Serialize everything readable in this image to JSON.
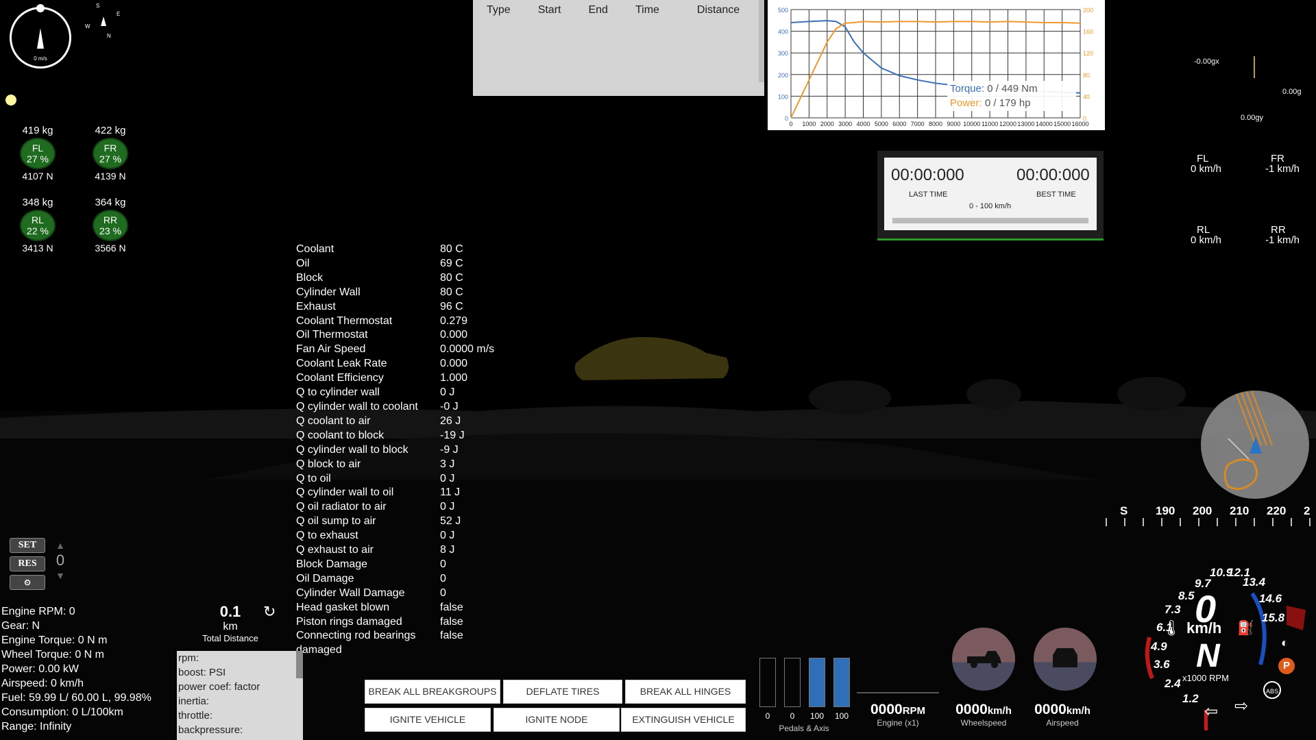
{
  "compass": {
    "speed": "0 m/s",
    "letters": [
      "S",
      "E",
      "W",
      "N"
    ]
  },
  "tires": [
    {
      "mass": "419  kg",
      "label": "FL",
      "pct": "27 %",
      "force": "4107  N"
    },
    {
      "mass": "422  kg",
      "label": "FR",
      "pct": "27 %",
      "force": "4139  N"
    },
    {
      "mass": "348  kg",
      "label": "RL",
      "pct": "22 %",
      "force": "3413  N"
    },
    {
      "mass": "364  kg",
      "label": "RR",
      "pct": "23 %",
      "force": "3566  N"
    }
  ],
  "thermal": [
    [
      "Coolant",
      "80 C"
    ],
    [
      "Oil",
      "69 C"
    ],
    [
      "Block",
      "80 C"
    ],
    [
      "Cylinder Wall",
      "80 C"
    ],
    [
      "Exhaust",
      "96 C"
    ],
    [
      "Coolant Thermostat",
      "0.279"
    ],
    [
      "Oil Thermostat",
      "0.000"
    ],
    [
      "Fan Air Speed",
      "0.0000 m/s"
    ],
    [
      "Coolant Leak Rate",
      "0.000"
    ],
    [
      "Coolant Efficiency",
      "1.000"
    ],
    [
      "Q to cylinder wall",
      "0 J"
    ],
    [
      "Q cylinder wall to coolant",
      "-0 J"
    ],
    [
      "Q coolant to air",
      "26 J"
    ],
    [
      "Q coolant to block",
      "-19 J"
    ],
    [
      "Q cylinder wall to block",
      "-9 J"
    ],
    [
      "Q block to air",
      "3 J"
    ],
    [
      "Q to oil",
      "0 J"
    ],
    [
      "Q cylinder wall to oil",
      "11 J"
    ],
    [
      "Q oil radiator to air",
      "0 J"
    ],
    [
      "Q oil sump to air",
      "52 J"
    ],
    [
      "Q to exhaust",
      "0 J"
    ],
    [
      "Q exhaust to air",
      "8 J"
    ],
    [
      "Block Damage",
      "0"
    ],
    [
      "Oil Damage",
      "0"
    ],
    [
      "Cylinder Wall Damage",
      "0"
    ],
    [
      "Head gasket blown",
      "false"
    ],
    [
      "Piston rings damaged",
      "false"
    ],
    [
      "Connecting rod bearings",
      "false"
    ],
    [
      "damaged",
      ""
    ]
  ],
  "lap": {
    "headers": [
      "Type",
      "Start",
      "End",
      "Time",
      "Distance"
    ]
  },
  "torque_chart": {
    "left_ticks": [
      "500",
      "400",
      "300",
      "200",
      "100",
      "0"
    ],
    "right_ticks": [
      "200",
      "160",
      "120",
      "80",
      "40",
      "0"
    ],
    "x_ticks": [
      "0",
      "1000",
      "2000",
      "3000",
      "4000",
      "5000",
      "6000",
      "7000",
      "8000",
      "9000",
      "10000",
      "11000",
      "12000",
      "13000",
      "14000",
      "15000",
      "16000"
    ],
    "torque_label": "Torque:",
    "torque_value": "0 / 449 Nm",
    "power_label": "Power:",
    "power_value": "0 / 179 hp",
    "torque_color": "#3b6fb5",
    "power_color": "#f0982a"
  },
  "chart_data": {
    "type": "line",
    "x": [
      0,
      1000,
      2000,
      2500,
      3000,
      3500,
      4000,
      5000,
      6000,
      7000,
      8000,
      9000,
      10000,
      11000,
      12000,
      13000,
      14000,
      15000,
      16000
    ],
    "series": [
      {
        "name": "Torque",
        "axis": "left",
        "values": [
          440,
          445,
          449,
          445,
          420,
          350,
          300,
          230,
          195,
          175,
          160,
          150,
          145,
          138,
          132,
          128,
          122,
          118,
          115
        ]
      },
      {
        "name": "Power",
        "axis": "right",
        "values": [
          0,
          70,
          140,
          165,
          175,
          176,
          178,
          177,
          178,
          178,
          177,
          178,
          178,
          177,
          178,
          177,
          176,
          176,
          175
        ]
      }
    ],
    "ylim_left": [
      0,
      500
    ],
    "ylim_right": [
      0,
      200
    ],
    "xlim": [
      0,
      16000
    ]
  },
  "timer": {
    "last": "00:00:000",
    "best": "00:00:000",
    "last_label": "LAST TIME",
    "best_label": "BEST TIME",
    "range": "0 - 100 km/h"
  },
  "gforce": {
    "gx": "-0.00gx",
    "g": "0.00g",
    "gy": "0.00gy"
  },
  "wheelspeeds": [
    {
      "label": "FL",
      "value": "0  km/h"
    },
    {
      "label": "FR",
      "value": "-1  km/h"
    },
    {
      "label": "RL",
      "value": "0  km/h"
    },
    {
      "label": "RR",
      "value": "-1  km/h"
    }
  ],
  "heading": {
    "labels": [
      "S",
      "190",
      "200",
      "210",
      "220",
      "2"
    ]
  },
  "cruise": {
    "set": "SET",
    "res": "RES",
    "value": "0"
  },
  "info": [
    "Engine RPM: 0",
    "Gear: N",
    "Engine Torque: 0 N m",
    "Wheel Torque: 0 N m",
    "Power: 0.00 kW",
    "Airspeed: 0 km/h",
    "Fuel: 59.99 L/ 60.00 L, 99.98%",
    "Consumption: 0 L/100km",
    "Range: Infinity"
  ],
  "distance": {
    "value": "0.1",
    "unit": "km",
    "label": "Total Distance"
  },
  "infobox": [
    "rpm:",
    "boost: PSI",
    "power coef: factor",
    "inertia:",
    "throttle:",
    "backpressure:"
  ],
  "buttons": {
    "break_groups": "BREAK ALL BREAKGROUPS",
    "deflate": "DEFLATE TIRES",
    "hinges": "BREAK ALL HINGES",
    "ignite_vehicle": "IGNITE VEHICLE",
    "ignite_node": "IGNITE NODE",
    "extinguish": "EXTINGUISH VEHICLE"
  },
  "pedals": {
    "values": [
      0,
      0,
      100,
      100
    ],
    "labels": [
      "0",
      "0",
      "100",
      "100"
    ],
    "caption": "Pedals & Axis"
  },
  "readouts": {
    "engine": {
      "value": "0000",
      "unit": "RPM",
      "caption": "Engine (x1)"
    },
    "wheel": {
      "value": "0000",
      "unit": "km/h",
      "caption": "Wheelspeed"
    },
    "air": {
      "value": "0000",
      "unit": "km/h",
      "caption": "Airspeed"
    }
  },
  "speedo": {
    "speed": "0",
    "unit": "km/h",
    "gear": "N",
    "rpm_label": "x1000 RPM",
    "scale": [
      "1.2",
      "2.4",
      "3.6",
      "4.9",
      "6.1",
      "7.3",
      "8.5",
      "9.7",
      "10.9",
      "12.1",
      "13.4",
      "14.6",
      "15.8"
    ],
    "abs": "ABS",
    "park": "P"
  }
}
